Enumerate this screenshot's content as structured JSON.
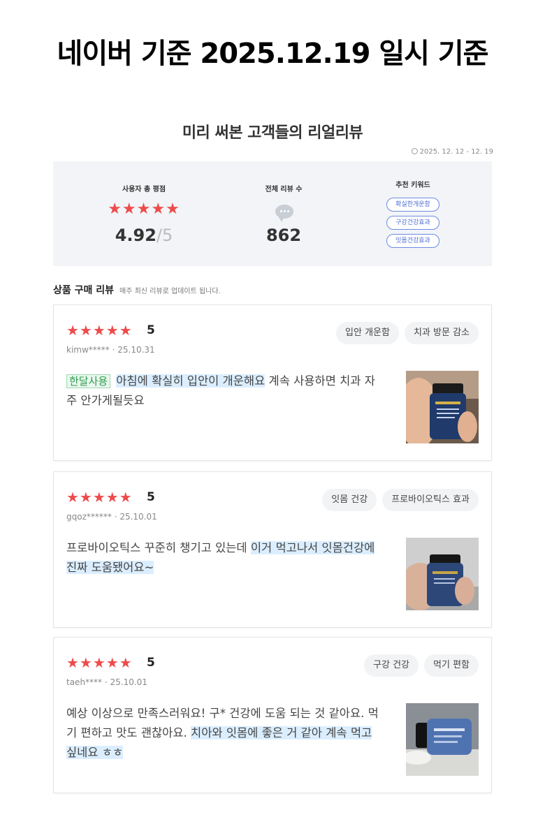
{
  "headline": "네이버 기준 2025.12.19 일시 기준",
  "section": {
    "title": "미리 써본 고객들의 리얼리뷰",
    "date_range": "2025. 12. 12 - 12. 19"
  },
  "summary": {
    "rating_label": "사용자 총 평점",
    "rating_stars": "★★★★★",
    "rating_value": "4.92",
    "rating_max": "/5",
    "count_label": "전체 리뷰 수",
    "count_value": "862",
    "keywords_label": "추천 키워드",
    "keywords": [
      "확실한개운함",
      "구강건강효과",
      "잇몸건강효과"
    ]
  },
  "reviews_header": {
    "title": "상품 구매 리뷰",
    "subtitle": "매주 최신 리뷰로 업데이트 됩니다."
  },
  "reviews": [
    {
      "stars": "★★★★★",
      "rating": "5",
      "user": "kimw*****",
      "date": "25.10.31",
      "tags": [
        "입안 개운함",
        "치과 방문 감소"
      ],
      "badge": "한달사용",
      "text_highlight": "아침에 확실히 입안이 개운해요",
      "text_rest": " 계속 사용하면 치과 자주 안가게될듯요",
      "photo": "bottle-in-hand"
    },
    {
      "stars": "★★★★★",
      "rating": "5",
      "user": "gqoz******",
      "date": "25.10.01",
      "tags": [
        "잇몸 건강",
        "프로바이오틱스 효과"
      ],
      "text_plain": "프로바이오틱스 꾸준히 챙기고 있는데 ",
      "text_highlight": "이거 먹고나서 잇몸건강에 진짜 도움됐어요~",
      "photo": "bottle-in-hand-blurred"
    },
    {
      "stars": "★★★★★",
      "rating": "5",
      "user": "taeh****",
      "date": "25.10.01",
      "tags": [
        "구강 건강",
        "먹기 편함"
      ],
      "text_plain": "예상 이상으로 만족스러워요! 구* 건강에 도움 되는 것 같아요. 먹기 편하고 맛도 괜찮아요. ",
      "text_highlight": "치아와 잇몸에 좋은 거 같아 계속 먹고 싶네요 ㅎㅎ",
      "photo": "bottle-on-table"
    }
  ],
  "colors": {
    "star": "#ee4b4b",
    "keyword": "#4a6cd4",
    "highlight": "#dbeeff",
    "badge": "#2e9e4f"
  }
}
